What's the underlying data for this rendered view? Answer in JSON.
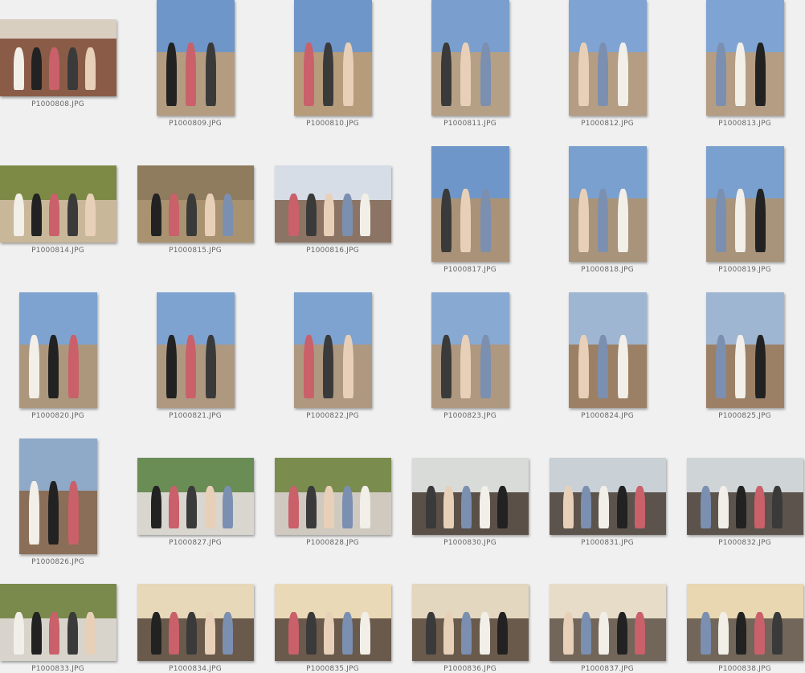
{
  "window": {
    "background": "#f0f0f0"
  },
  "photos": [
    {
      "filename": "P1000808.JPG",
      "orientation": "landscape",
      "scene": "group-close",
      "sky": "#d9cfc1",
      "ground": "#8a5c48"
    },
    {
      "filename": "P1000809.JPG",
      "orientation": "portrait",
      "scene": "beach-building",
      "sky": "#6f96c8",
      "ground": "#b39c80"
    },
    {
      "filename": "P1000810.JPG",
      "orientation": "portrait",
      "scene": "beach-building",
      "sky": "#6f96c8",
      "ground": "#b69c7b"
    },
    {
      "filename": "P1000811.JPG",
      "orientation": "portrait",
      "scene": "beach-building",
      "sky": "#7a9fcf",
      "ground": "#b5a086"
    },
    {
      "filename": "P1000812.JPG",
      "orientation": "portrait",
      "scene": "beach-building",
      "sky": "#7fa4d3",
      "ground": "#b49d83"
    },
    {
      "filename": "P1000813.JPG",
      "orientation": "portrait",
      "scene": "beach-building",
      "sky": "#7fa4d3",
      "ground": "#b49d83"
    },
    {
      "filename": "P1000814.JPG",
      "orientation": "landscape",
      "scene": "garden",
      "sky": "#7c8a45",
      "ground": "#c9b79a"
    },
    {
      "filename": "P1000815.JPG",
      "orientation": "landscape",
      "scene": "courtyard",
      "sky": "#8f7b5d",
      "ground": "#a9926f"
    },
    {
      "filename": "P1000816.JPG",
      "orientation": "landscape",
      "scene": "sea-couple",
      "sky": "#d7dde6",
      "ground": "#8c7464"
    },
    {
      "filename": "P1000817.JPG",
      "orientation": "portrait",
      "scene": "beach-building",
      "sky": "#6f96c8",
      "ground": "#a99277"
    },
    {
      "filename": "P1000818.JPG",
      "orientation": "portrait",
      "scene": "beach-building",
      "sky": "#7aa0cf",
      "ground": "#a8937b"
    },
    {
      "filename": "P1000819.JPG",
      "orientation": "portrait",
      "scene": "beach-building",
      "sky": "#7aa0cf",
      "ground": "#a8937b"
    },
    {
      "filename": "P1000820.JPG",
      "orientation": "portrait",
      "scene": "beach-building",
      "sky": "#7ea3d1",
      "ground": "#ac977d"
    },
    {
      "filename": "P1000821.JPG",
      "orientation": "portrait",
      "scene": "beach-building",
      "sky": "#7ea3d1",
      "ground": "#ae9880"
    },
    {
      "filename": "P1000822.JPG",
      "orientation": "portrait",
      "scene": "beach-building",
      "sky": "#7ea3d1",
      "ground": "#ae9880"
    },
    {
      "filename": "P1000823.JPG",
      "orientation": "portrait",
      "scene": "beach-building",
      "sky": "#88a9d2",
      "ground": "#ae9880"
    },
    {
      "filename": "P1000824.JPG",
      "orientation": "portrait",
      "scene": "beach-rocks",
      "sky": "#9fb6d2",
      "ground": "#9c8066"
    },
    {
      "filename": "P1000825.JPG",
      "orientation": "portrait",
      "scene": "beach-rocks",
      "sky": "#9fb6d2",
      "ground": "#9c8066"
    },
    {
      "filename": "P1000826.JPG",
      "orientation": "portrait",
      "scene": "beach-rocks",
      "sky": "#8fa9c8",
      "ground": "#8a6e57"
    },
    {
      "filename": "P1000827.JPG",
      "orientation": "landscape",
      "scene": "terrace",
      "sky": "#6a8c55",
      "ground": "#d9d5cf"
    },
    {
      "filename": "P1000828.JPG",
      "orientation": "landscape",
      "scene": "terrace",
      "sky": "#7a8c4e",
      "ground": "#cfc9c0"
    },
    {
      "filename": "P1000830.JPG",
      "orientation": "landscape",
      "scene": "crowd-sunset",
      "sky": "#d8dbd8",
      "ground": "#5a5048"
    },
    {
      "filename": "P1000831.JPG",
      "orientation": "landscape",
      "scene": "crowd-sunset",
      "sky": "#c9d0d6",
      "ground": "#5c544c"
    },
    {
      "filename": "P1000832.JPG",
      "orientation": "landscape",
      "scene": "crowd-sunset",
      "sky": "#cfd4d6",
      "ground": "#5c544c"
    },
    {
      "filename": "P1000833.JPG",
      "orientation": "landscape",
      "scene": "terrace",
      "sky": "#7a8a4c",
      "ground": "#d8d4cc"
    },
    {
      "filename": "P1000834.JPG",
      "orientation": "landscape",
      "scene": "crowd-sunset",
      "sky": "#e6d8b8",
      "ground": "#6a5a4c"
    },
    {
      "filename": "P1000835.JPG",
      "orientation": "landscape",
      "scene": "crowd-sunset",
      "sky": "#ead9b6",
      "ground": "#6a5a4c"
    },
    {
      "filename": "P1000836.JPG",
      "orientation": "landscape",
      "scene": "crowd-sunset",
      "sky": "#e3d7bf",
      "ground": "#6a5a4c"
    },
    {
      "filename": "P1000837.JPG",
      "orientation": "landscape",
      "scene": "crowd-sunset",
      "sky": "#e6dcc8",
      "ground": "#72665a"
    },
    {
      "filename": "P1000838.JPG",
      "orientation": "landscape",
      "scene": "crowd-sunset",
      "sky": "#e8d7b0",
      "ground": "#72665a"
    }
  ]
}
